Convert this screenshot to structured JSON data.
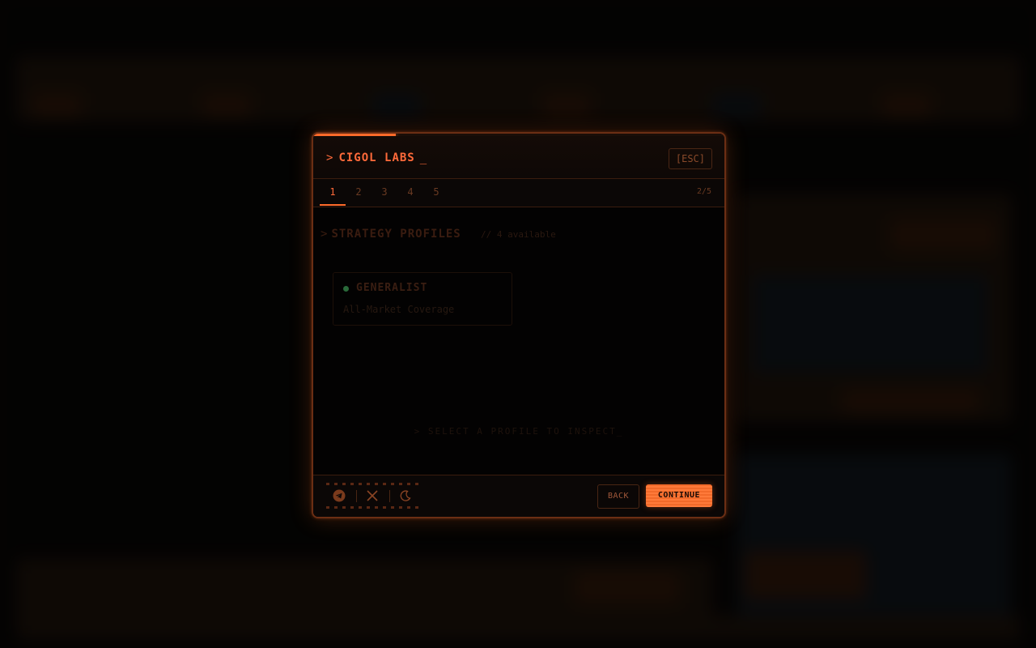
{
  "modal": {
    "title": "CIGOL LABS",
    "cursor": "_",
    "prompt": ">",
    "esc_label": "[ESC]",
    "progress_percent": 20
  },
  "steps": {
    "tabs": [
      "1",
      "2",
      "3",
      "4",
      "5"
    ],
    "active": "1",
    "counter": "2/5"
  },
  "section": {
    "prompt": ">",
    "title": "STRATEGY PROFILES",
    "subtitle": "// 4 available"
  },
  "profile_card": {
    "name": "GENERALIST",
    "description": "All-Market Coverage",
    "status_color": "#2a6a3a"
  },
  "hint": "> SELECT A PROFILE TO INSPECT_",
  "footer": {
    "social_icons": [
      "telegram-icon",
      "x-twitter-icon",
      "moon-icon"
    ],
    "back_label": "BACK",
    "continue_label": "CONTINUE"
  },
  "colors": {
    "accent": "#ff6a2a",
    "border": "#6b2e14",
    "background": "#0b0706"
  }
}
